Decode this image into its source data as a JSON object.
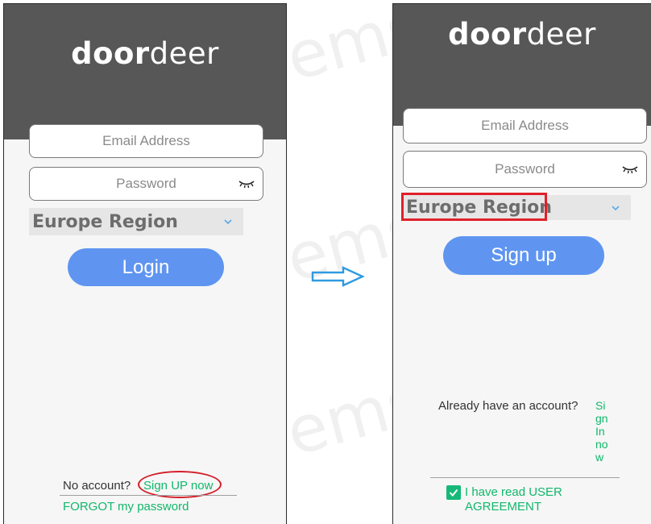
{
  "login_screen": {
    "logo": {
      "bold": "door",
      "light": "deer"
    },
    "email_placeholder": "Email Address",
    "password_placeholder": "Password",
    "region": "Europe Region",
    "login_button": "Login",
    "no_account_text": "No account?",
    "signup_link": "Sign UP now",
    "forgot_link": "FORGOT my password"
  },
  "signup_screen": {
    "logo": {
      "bold": "door",
      "light": "deer"
    },
    "email_placeholder": "Email Address",
    "password_placeholder": "Password",
    "region": "Europe Region",
    "signup_button": "Sign up",
    "already_text": "Already have an account?",
    "signin_link": "Si\ngn\nIn\nno\nw",
    "agreement_text": "I have read USER\nAGREEMENT",
    "agreement_checked": true
  },
  "watermark": "ems",
  "colors": {
    "header": "#575757",
    "accent_button": "#5f95f0",
    "link_green": "#10b86a",
    "highlight_red": "#e0202a",
    "arrow_blue": "#2e9be0"
  },
  "icons": {
    "eye": "eye-closed-icon",
    "chevron": "chevron-down-icon",
    "arrow": "arrow-right-icon",
    "check": "check-icon"
  }
}
